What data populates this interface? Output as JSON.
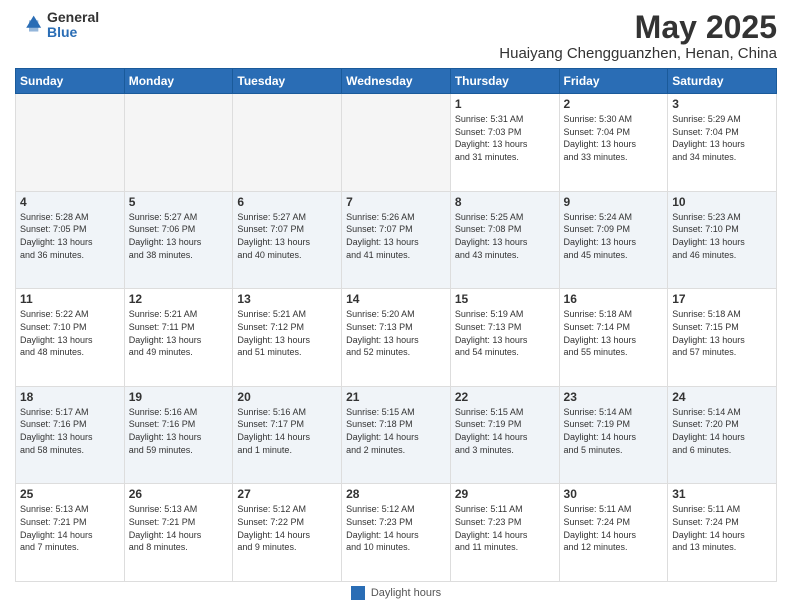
{
  "header": {
    "logo_general": "General",
    "logo_blue": "Blue",
    "month_title": "May 2025",
    "location": "Huaiyang Chengguanzhen, Henan, China"
  },
  "weekdays": [
    "Sunday",
    "Monday",
    "Tuesday",
    "Wednesday",
    "Thursday",
    "Friday",
    "Saturday"
  ],
  "footer": {
    "label": "Daylight hours"
  },
  "weeks": [
    [
      {
        "day": "",
        "info": ""
      },
      {
        "day": "",
        "info": ""
      },
      {
        "day": "",
        "info": ""
      },
      {
        "day": "",
        "info": ""
      },
      {
        "day": "1",
        "info": "Sunrise: 5:31 AM\nSunset: 7:03 PM\nDaylight: 13 hours\nand 31 minutes."
      },
      {
        "day": "2",
        "info": "Sunrise: 5:30 AM\nSunset: 7:04 PM\nDaylight: 13 hours\nand 33 minutes."
      },
      {
        "day": "3",
        "info": "Sunrise: 5:29 AM\nSunset: 7:04 PM\nDaylight: 13 hours\nand 34 minutes."
      }
    ],
    [
      {
        "day": "4",
        "info": "Sunrise: 5:28 AM\nSunset: 7:05 PM\nDaylight: 13 hours\nand 36 minutes."
      },
      {
        "day": "5",
        "info": "Sunrise: 5:27 AM\nSunset: 7:06 PM\nDaylight: 13 hours\nand 38 minutes."
      },
      {
        "day": "6",
        "info": "Sunrise: 5:27 AM\nSunset: 7:07 PM\nDaylight: 13 hours\nand 40 minutes."
      },
      {
        "day": "7",
        "info": "Sunrise: 5:26 AM\nSunset: 7:07 PM\nDaylight: 13 hours\nand 41 minutes."
      },
      {
        "day": "8",
        "info": "Sunrise: 5:25 AM\nSunset: 7:08 PM\nDaylight: 13 hours\nand 43 minutes."
      },
      {
        "day": "9",
        "info": "Sunrise: 5:24 AM\nSunset: 7:09 PM\nDaylight: 13 hours\nand 45 minutes."
      },
      {
        "day": "10",
        "info": "Sunrise: 5:23 AM\nSunset: 7:10 PM\nDaylight: 13 hours\nand 46 minutes."
      }
    ],
    [
      {
        "day": "11",
        "info": "Sunrise: 5:22 AM\nSunset: 7:10 PM\nDaylight: 13 hours\nand 48 minutes."
      },
      {
        "day": "12",
        "info": "Sunrise: 5:21 AM\nSunset: 7:11 PM\nDaylight: 13 hours\nand 49 minutes."
      },
      {
        "day": "13",
        "info": "Sunrise: 5:21 AM\nSunset: 7:12 PM\nDaylight: 13 hours\nand 51 minutes."
      },
      {
        "day": "14",
        "info": "Sunrise: 5:20 AM\nSunset: 7:13 PM\nDaylight: 13 hours\nand 52 minutes."
      },
      {
        "day": "15",
        "info": "Sunrise: 5:19 AM\nSunset: 7:13 PM\nDaylight: 13 hours\nand 54 minutes."
      },
      {
        "day": "16",
        "info": "Sunrise: 5:18 AM\nSunset: 7:14 PM\nDaylight: 13 hours\nand 55 minutes."
      },
      {
        "day": "17",
        "info": "Sunrise: 5:18 AM\nSunset: 7:15 PM\nDaylight: 13 hours\nand 57 minutes."
      }
    ],
    [
      {
        "day": "18",
        "info": "Sunrise: 5:17 AM\nSunset: 7:16 PM\nDaylight: 13 hours\nand 58 minutes."
      },
      {
        "day": "19",
        "info": "Sunrise: 5:16 AM\nSunset: 7:16 PM\nDaylight: 13 hours\nand 59 minutes."
      },
      {
        "day": "20",
        "info": "Sunrise: 5:16 AM\nSunset: 7:17 PM\nDaylight: 14 hours\nand 1 minute."
      },
      {
        "day": "21",
        "info": "Sunrise: 5:15 AM\nSunset: 7:18 PM\nDaylight: 14 hours\nand 2 minutes."
      },
      {
        "day": "22",
        "info": "Sunrise: 5:15 AM\nSunset: 7:19 PM\nDaylight: 14 hours\nand 3 minutes."
      },
      {
        "day": "23",
        "info": "Sunrise: 5:14 AM\nSunset: 7:19 PM\nDaylight: 14 hours\nand 5 minutes."
      },
      {
        "day": "24",
        "info": "Sunrise: 5:14 AM\nSunset: 7:20 PM\nDaylight: 14 hours\nand 6 minutes."
      }
    ],
    [
      {
        "day": "25",
        "info": "Sunrise: 5:13 AM\nSunset: 7:21 PM\nDaylight: 14 hours\nand 7 minutes."
      },
      {
        "day": "26",
        "info": "Sunrise: 5:13 AM\nSunset: 7:21 PM\nDaylight: 14 hours\nand 8 minutes."
      },
      {
        "day": "27",
        "info": "Sunrise: 5:12 AM\nSunset: 7:22 PM\nDaylight: 14 hours\nand 9 minutes."
      },
      {
        "day": "28",
        "info": "Sunrise: 5:12 AM\nSunset: 7:23 PM\nDaylight: 14 hours\nand 10 minutes."
      },
      {
        "day": "29",
        "info": "Sunrise: 5:11 AM\nSunset: 7:23 PM\nDaylight: 14 hours\nand 11 minutes."
      },
      {
        "day": "30",
        "info": "Sunrise: 5:11 AM\nSunset: 7:24 PM\nDaylight: 14 hours\nand 12 minutes."
      },
      {
        "day": "31",
        "info": "Sunrise: 5:11 AM\nSunset: 7:24 PM\nDaylight: 14 hours\nand 13 minutes."
      }
    ]
  ]
}
